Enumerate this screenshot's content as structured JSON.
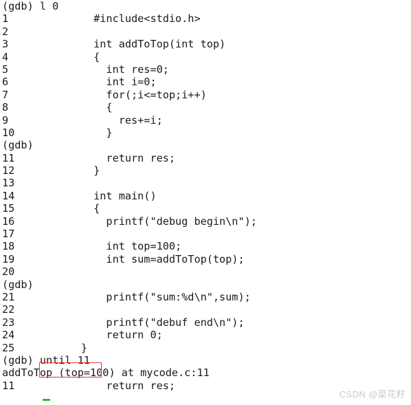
{
  "terminal": {
    "type": "gdb-session",
    "background_color": "#ffffff",
    "text_color": "#1a1a1a",
    "lines": [
      {
        "kind": "prompt",
        "lineno": "",
        "text": "(gdb) l 0"
      },
      {
        "kind": "source",
        "lineno": "1",
        "text": "        #include<stdio.h>"
      },
      {
        "kind": "source",
        "lineno": "2",
        "text": ""
      },
      {
        "kind": "source",
        "lineno": "3",
        "text": "        int addToTop(int top)"
      },
      {
        "kind": "source",
        "lineno": "4",
        "text": "        {"
      },
      {
        "kind": "source",
        "lineno": "5",
        "text": "          int res=0;"
      },
      {
        "kind": "source",
        "lineno": "6",
        "text": "          int i=0;"
      },
      {
        "kind": "source",
        "lineno": "7",
        "text": "          for(;i<=top;i++)"
      },
      {
        "kind": "source",
        "lineno": "8",
        "text": "          {"
      },
      {
        "kind": "source",
        "lineno": "9",
        "text": "            res+=i;"
      },
      {
        "kind": "source",
        "lineno": "10",
        "text": "          }"
      },
      {
        "kind": "prompt",
        "lineno": "",
        "text": "(gdb)"
      },
      {
        "kind": "source",
        "lineno": "11",
        "text": "          return res;"
      },
      {
        "kind": "source",
        "lineno": "12",
        "text": "        }"
      },
      {
        "kind": "source",
        "lineno": "13",
        "text": ""
      },
      {
        "kind": "source",
        "lineno": "14",
        "text": "        int main()"
      },
      {
        "kind": "source",
        "lineno": "15",
        "text": "        {"
      },
      {
        "kind": "source",
        "lineno": "16",
        "text": "          printf(\"debug begin\\n\");"
      },
      {
        "kind": "source",
        "lineno": "17",
        "text": ""
      },
      {
        "kind": "source",
        "lineno": "18",
        "text": "          int top=100;"
      },
      {
        "kind": "source",
        "lineno": "19",
        "text": "          int sum=addToTop(top);"
      },
      {
        "kind": "source",
        "lineno": "20",
        "text": ""
      },
      {
        "kind": "prompt",
        "lineno": "",
        "text": "(gdb)"
      },
      {
        "kind": "source",
        "lineno": "21",
        "text": "          printf(\"sum:%d\\n\",sum);"
      },
      {
        "kind": "source",
        "lineno": "22",
        "text": ""
      },
      {
        "kind": "source",
        "lineno": "23",
        "text": "          printf(\"debuf end\\n\");"
      },
      {
        "kind": "source",
        "lineno": "24",
        "text": "          return 0;"
      },
      {
        "kind": "source",
        "lineno": "25",
        "text": "      }"
      },
      {
        "kind": "command",
        "lineno": "",
        "text": "(gdb) until 11"
      },
      {
        "kind": "output",
        "lineno": "",
        "text": "addToTop (top=100) at mycode.c:11"
      },
      {
        "kind": "source",
        "lineno": "11",
        "text": "          return res;"
      },
      {
        "kind": "blank",
        "lineno": "",
        "text": ""
      }
    ]
  },
  "annotation": {
    "highlight_box_color": "#e8352c",
    "highlight_target_text": "until 11",
    "cursor_color": "#2fbf2f"
  },
  "watermark": {
    "text": "CSDN @菜花籽",
    "color": "#c9c9c9"
  }
}
